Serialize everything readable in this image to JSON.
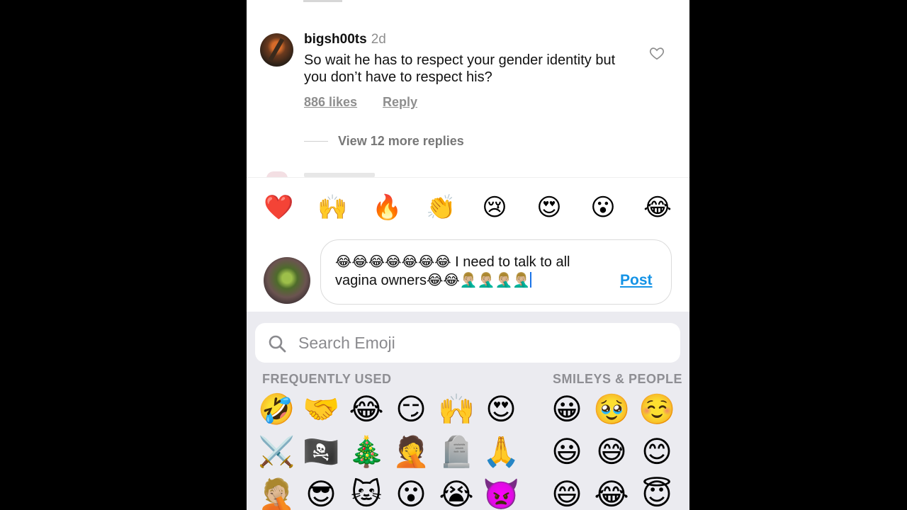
{
  "comment": {
    "username": "bigsh00ts",
    "time": "2d",
    "text": "So wait he has to respect your gender identity but you don’t have to respect his?",
    "likes": "886 likes",
    "reply": "Reply",
    "view_replies": "View 12 more replies"
  },
  "reactions": [
    "❤️",
    "🙌",
    "🔥",
    "👏",
    "😢",
    "😍",
    "😮",
    "😂"
  ],
  "composer": {
    "text": "😂😂😂😂😂😂😂 I need to talk to all vagina owners😂😂🤦🏼‍♂️🤦🏼‍♂️🤦🏼‍♂️🤦🏼‍♂️",
    "post_label": "Post"
  },
  "keyboard": {
    "search_placeholder": "Search Emoji",
    "section_frequent": "FREQUENTLY USED",
    "section_smileys": "SMILEYS & PEOPLE",
    "frequent_rows": [
      [
        "🤣",
        "🤝",
        "😂",
        "😏",
        "🙌",
        "😍"
      ],
      [
        "⚔️",
        "🏴‍☠️",
        "🎄",
        "🤦",
        "🪦",
        "🙏"
      ],
      [
        "🤦🏼",
        "😎",
        "🐱",
        "😮",
        "😭",
        "👿"
      ]
    ],
    "smileys_rows": [
      [
        "😀",
        "🥹",
        "☺️"
      ],
      [
        "😃",
        "😅",
        "😊"
      ],
      [
        "😄",
        "😂",
        "😇"
      ]
    ]
  },
  "colors": {
    "accent": "#1493e6",
    "secondary_text": "#8e8e8e"
  }
}
